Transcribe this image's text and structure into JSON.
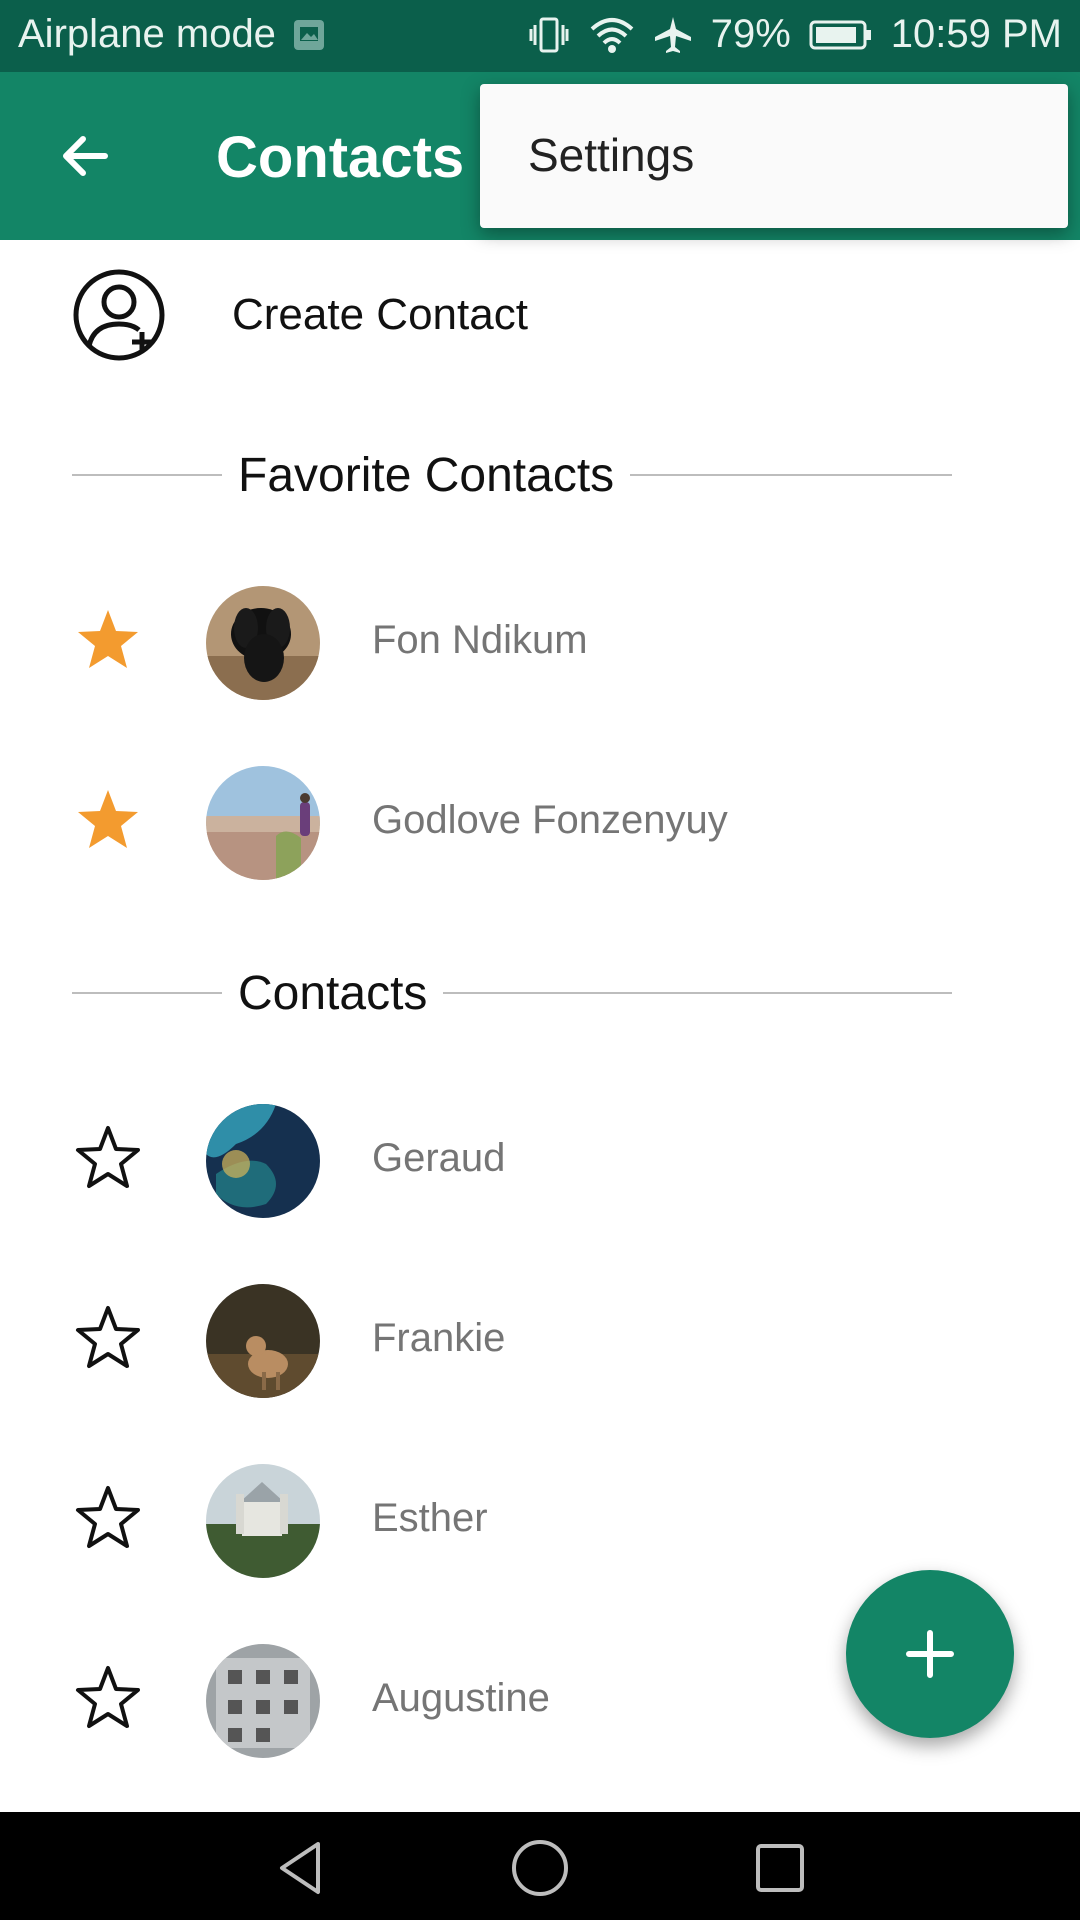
{
  "status_bar": {
    "left_text": "Airplane mode",
    "battery_percent": "79%",
    "time": "10:59 PM",
    "icons": [
      "image-notification-icon",
      "vibrate-icon",
      "wifi-icon",
      "airplane-icon",
      "battery-icon"
    ]
  },
  "app_bar": {
    "title": "Contacts",
    "back_icon": "arrow-back-icon",
    "background": "#138566"
  },
  "overflow_menu": {
    "items": [
      {
        "label": "Settings"
      }
    ]
  },
  "create_contact": {
    "label": "Create Contact",
    "icon": "add-person-icon"
  },
  "favorites": {
    "header": "Favorite Contacts",
    "items": [
      {
        "name": "Fon Ndikum",
        "starred": true
      },
      {
        "name": "Godlove Fonzenyuy",
        "starred": true
      }
    ]
  },
  "contacts": {
    "header": "Contacts",
    "items": [
      {
        "name": "Geraud",
        "starred": false
      },
      {
        "name": "Frankie",
        "starred": false
      },
      {
        "name": "Esther",
        "starred": false
      },
      {
        "name": "Augustine",
        "starred": false
      }
    ]
  },
  "fab": {
    "icon": "plus-icon"
  },
  "nav_bar": {
    "icons": [
      "back-triangle-icon",
      "home-circle-icon",
      "recents-square-icon"
    ]
  },
  "colors": {
    "accent": "#138566",
    "status_bar": "#0b5f4b",
    "star_filled": "#f39b2f"
  }
}
